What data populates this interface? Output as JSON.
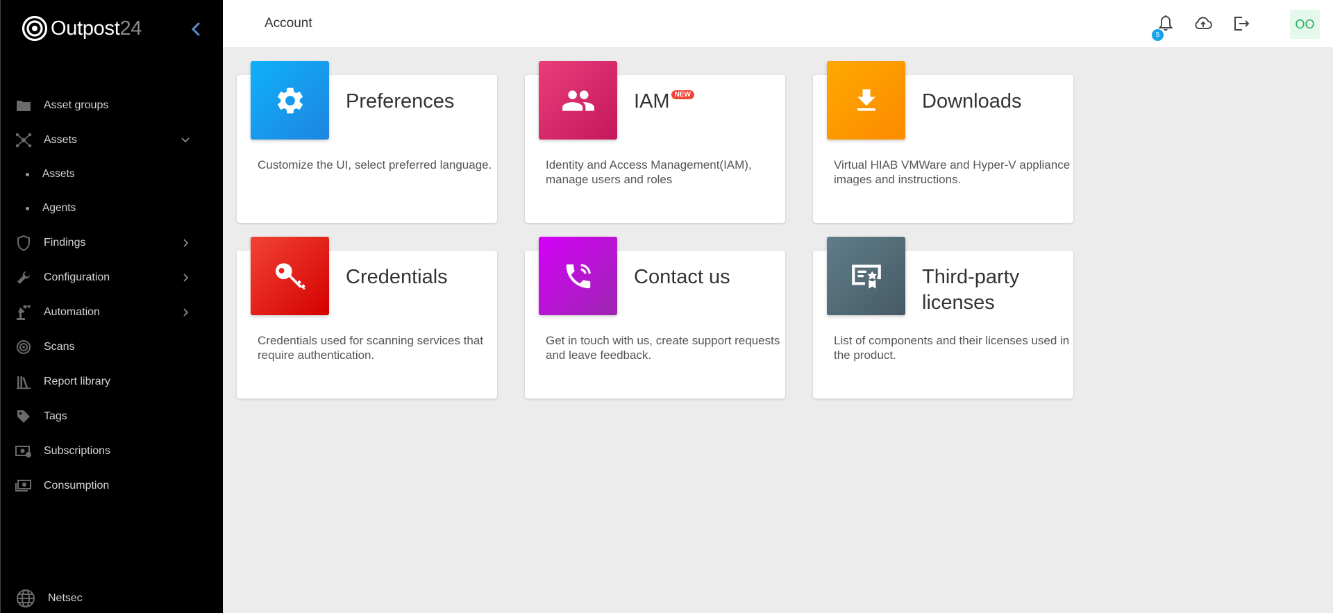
{
  "app": {
    "brand_name": "Outpost",
    "brand_num": "24"
  },
  "header": {
    "title": "Account",
    "notification_count": "5",
    "avatar_initials": "OO"
  },
  "sidebar": {
    "items": [
      {
        "label": "Asset groups"
      },
      {
        "label": "Assets"
      },
      {
        "label": "Assets"
      },
      {
        "label": "Agents"
      },
      {
        "label": "Findings"
      },
      {
        "label": "Configuration"
      },
      {
        "label": "Automation"
      },
      {
        "label": "Scans"
      },
      {
        "label": "Report library"
      },
      {
        "label": "Tags"
      },
      {
        "label": "Subscriptions"
      },
      {
        "label": "Consumption"
      }
    ],
    "footer_label": "Netsec"
  },
  "cards": [
    {
      "title": "Preferences",
      "desc": "Customize the UI, select preferred language.",
      "icon": "gear-icon",
      "color_from": "#0fb1f9",
      "color_to": "#1e84e0"
    },
    {
      "title": "IAM",
      "badge": "NEW",
      "desc": "Identity and Access Management(IAM), manage users and roles",
      "icon": "people-icon",
      "color_from": "#ea3d7b",
      "color_to": "#c2185b"
    },
    {
      "title": "Downloads",
      "desc": "Virtual HIAB VMWare and Hyper-V appliance images and instructions.",
      "icon": "download-icon",
      "color_from": "#ffa800",
      "color_to": "#fb8a00"
    },
    {
      "title": "Credentials",
      "desc": "Credentials used for scanning services that require authentication.",
      "icon": "key-icon",
      "color_from": "#f14336",
      "color_to": "#d40000"
    },
    {
      "title": "Contact us",
      "desc": "Get in touch with us, create support requests and leave feedback.",
      "icon": "phone-icon",
      "color_from": "#d500f9",
      "color_to": "#9c27b0"
    },
    {
      "title": "Third-party licenses",
      "desc": "List of components and their licenses used in the product.",
      "icon": "certificate-icon",
      "color_from": "#607d8b",
      "color_to": "#455a64"
    }
  ]
}
